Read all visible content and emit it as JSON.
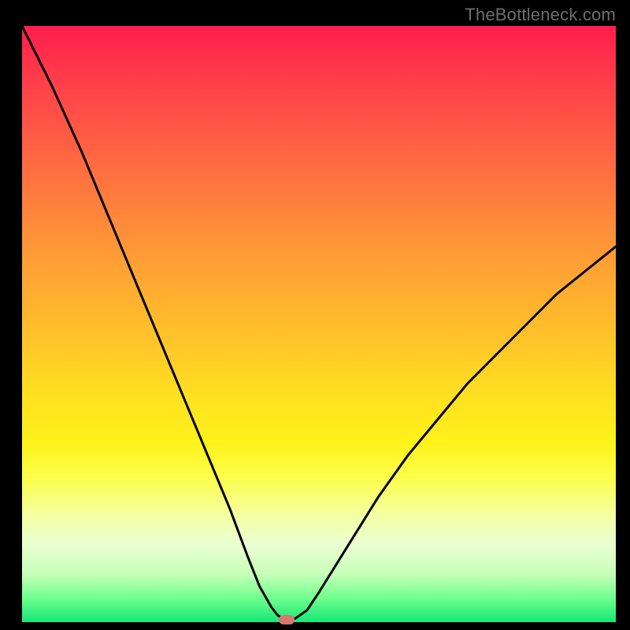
{
  "watermark": "TheBottleneck.com",
  "colors": {
    "curve_stroke": "#000000",
    "marker_fill": "#d9766e",
    "background": "#000000"
  },
  "chart_data": {
    "type": "line",
    "title": "",
    "xlabel": "",
    "ylabel": "",
    "xlim": [
      0,
      100
    ],
    "ylim": [
      0,
      100
    ],
    "grid": false,
    "legend": false,
    "series": [
      {
        "name": "bottleneck-curve",
        "x": [
          0,
          5,
          10,
          15,
          20,
          25,
          30,
          35,
          38,
          40,
          42,
          43,
          44,
          45,
          46,
          48,
          50,
          55,
          60,
          65,
          70,
          75,
          80,
          85,
          90,
          95,
          100
        ],
        "y": [
          100,
          90,
          79,
          67,
          55,
          43,
          31,
          19,
          11,
          6,
          2.5,
          1.2,
          0.5,
          0.4,
          0.6,
          2,
          5,
          13,
          21,
          28,
          34,
          40,
          45,
          50,
          55,
          59,
          63
        ]
      }
    ],
    "marker": {
      "x": 44.5,
      "y": 0.4
    }
  }
}
